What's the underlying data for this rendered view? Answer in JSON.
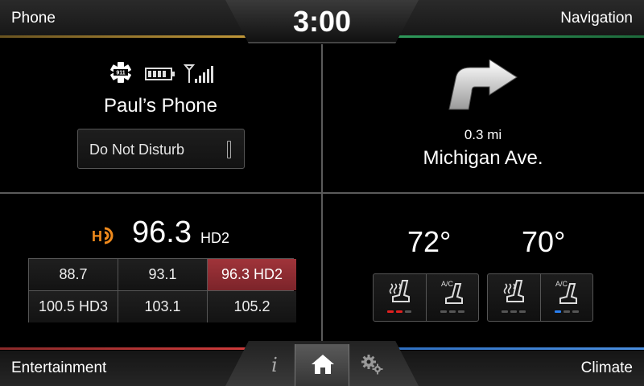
{
  "header": {
    "clock": "3:00",
    "left_label": "Phone",
    "right_label": "Navigation"
  },
  "phone": {
    "emergency_badge": "911",
    "device_name": "Paul’s Phone",
    "dnd_label": "Do Not Disturb",
    "battery_cells": 4,
    "signal_bars": 5
  },
  "navigation": {
    "distance": "0.3 mi",
    "street": "Michigan Ave.",
    "turn_icon": "turn-right-arrow-icon"
  },
  "entertainment": {
    "hd_icon": "hd-radio-icon",
    "station": "96.3",
    "sub_channel": "HD2",
    "presets": [
      "88.7",
      "93.1",
      "96.3 HD2",
      "100.5 HD3",
      "103.1",
      "105.2"
    ],
    "active_preset": 2
  },
  "climate": {
    "left_temp": "72°",
    "right_temp": "70°",
    "heated_seat_label": "heated-seat-icon",
    "ac_seat_label": "A/C",
    "driver_heat_level": 2,
    "passenger_ac_level": 1,
    "heat_color": "#e02020",
    "cool_color": "#2a7ff0"
  },
  "footer": {
    "left_label": "Entertainment",
    "right_label": "Climate",
    "info_glyph": "i"
  },
  "colors": {
    "phone_accent": "#c49a3a",
    "nav_accent": "#2f9b5c",
    "entertainment_accent": "#d23c3c",
    "climate_accent": "#4a8fe0",
    "active_preset": "#8c2c32"
  }
}
